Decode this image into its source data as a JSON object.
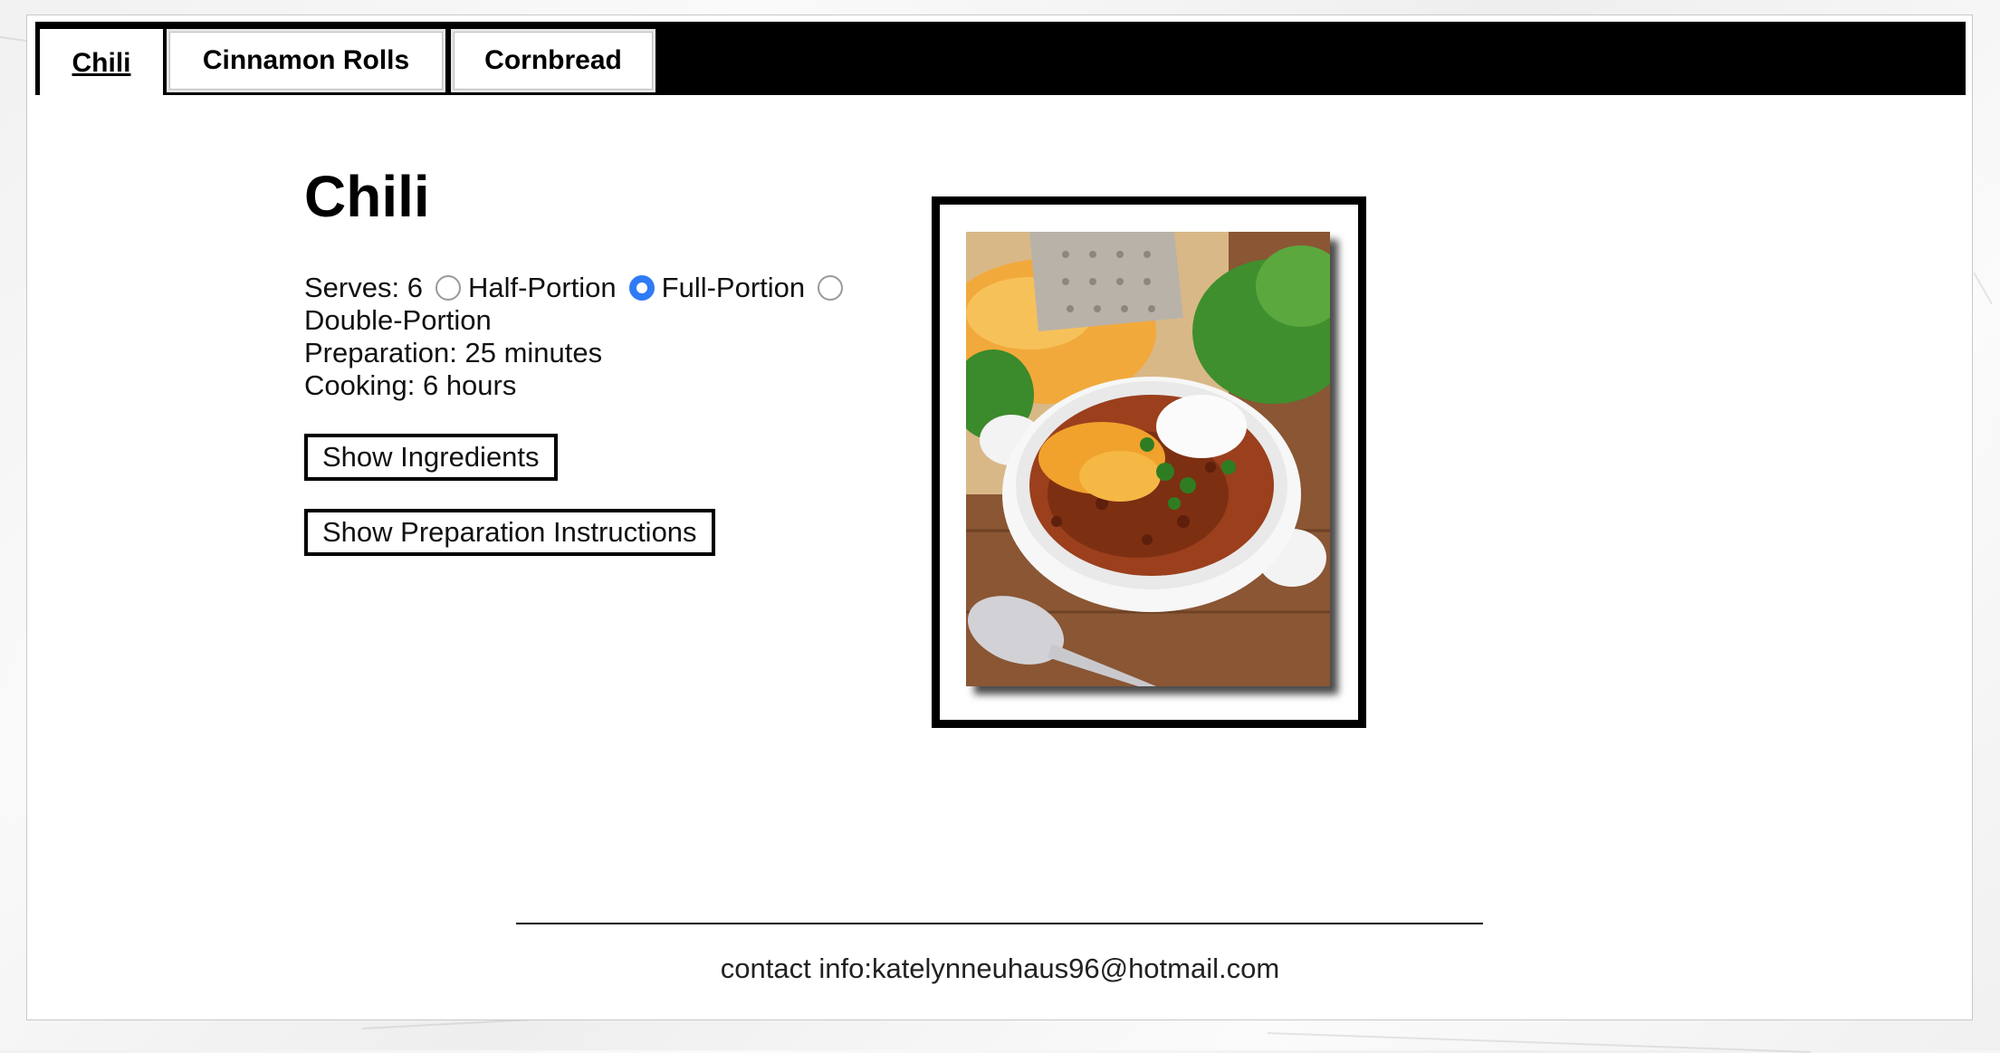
{
  "tabs": [
    {
      "label": "Chili",
      "active": true
    },
    {
      "label": "Cinnamon Rolls",
      "active": false
    },
    {
      "label": "Cornbread",
      "active": false
    }
  ],
  "recipe": {
    "title": "Chili",
    "serves_label": "Serves: 6",
    "portions": [
      {
        "label": "Half-Portion",
        "selected": false
      },
      {
        "label": "Full-Portion",
        "selected": true
      },
      {
        "label": "Double-Portion",
        "selected": false
      }
    ],
    "preparation": "Preparation: 25 minutes",
    "cooking": "Cooking: 6 hours",
    "show_ingredients_label": "Show Ingredients",
    "show_instructions_label": "Show Preparation Instructions"
  },
  "footer": {
    "contact": "contact info:katelynneuhaus96@hotmail.com"
  },
  "colors": {
    "tabbar_bg": "#000000",
    "radio_selected": "#2f7bf5"
  },
  "icons": {
    "dish_image": "chili-bowl-photo"
  }
}
